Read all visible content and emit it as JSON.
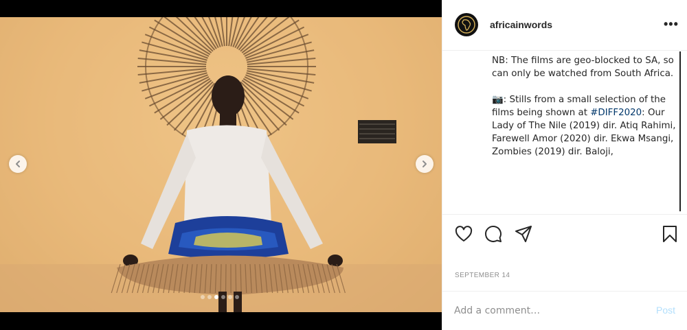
{
  "post": {
    "username": "africainwords",
    "more_label": "•••",
    "caption_paragraphs": [
      "NB: The films are geo-blocked to SA, so can only be watched from South Africa.",
      ""
    ],
    "caption_line2_prefix": "📷: Stills from a small selection of the films being shown at ",
    "caption_hashtag": "#DIFF2020",
    "caption_line2_suffix": ": Our Lady of The Nile (2019) dir. Atiq Rahimi, Farewell Amor (2020) dir. Ekwa Msangi, Zombies (2019) dir. Baloji,",
    "date": "SEPTEMBER 14"
  },
  "carousel": {
    "total_slides": 6,
    "active_slide": 3
  },
  "comment": {
    "placeholder": "Add a comment…",
    "post_label": "Post"
  },
  "colors": {
    "link": "#00376b",
    "post_disabled": "#b2dffc",
    "muted": "#8e8e8e"
  },
  "icons": {
    "like": "heart-icon",
    "comment": "comment-bubble-icon",
    "share": "paper-plane-icon",
    "save": "bookmark-icon",
    "prev": "chevron-left-icon",
    "next": "chevron-right-icon"
  }
}
